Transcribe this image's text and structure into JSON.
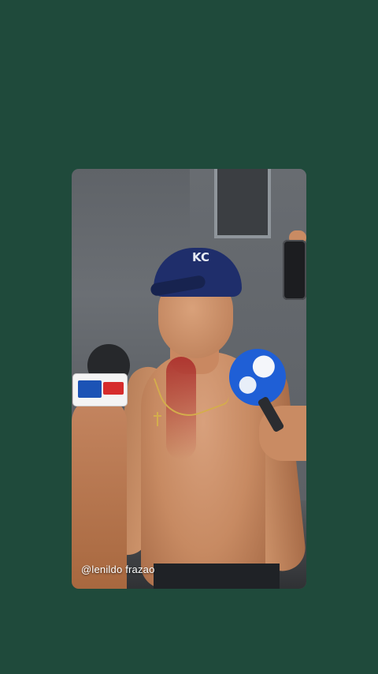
{
  "story": {
    "watermark": "@lenildo frazao",
    "cap_logo": "KC"
  },
  "colors": {
    "background": "#1f4a3b",
    "cap": "#1f2e6b",
    "mic_blue": "#1f5fd6"
  }
}
